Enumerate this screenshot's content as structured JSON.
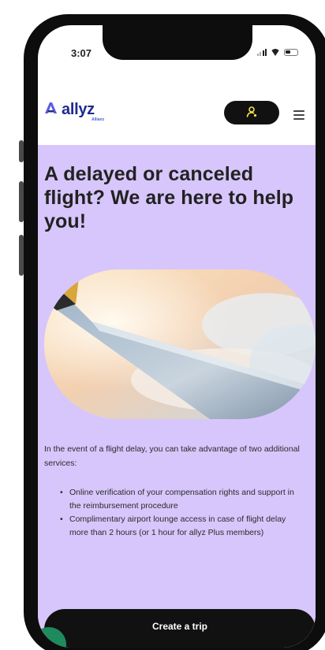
{
  "status_bar": {
    "time": "3:07"
  },
  "header": {
    "logo_text": "allyz",
    "logo_sub": "Allianz",
    "user_icon": "user-key-icon",
    "menu_icon": "hamburger-menu-icon"
  },
  "main": {
    "headline": "A delayed or canceled flight? We are here to help you!",
    "intro": "In the event of a flight delay, you can take advantage of two additional services:",
    "benefits": [
      "Online verification of your compensation rights and support in the reimbursement procedure",
      "Complimentary airport lounge access in case of flight delay more than 2 hours (or 1 hour for allyz Plus members)"
    ],
    "cta_label": "Create a trip"
  },
  "colors": {
    "brand_blue": "#1e2a8f",
    "accent_yellow": "#f2e14c",
    "content_bg": "#d7c6fb",
    "button_dark": "#111111",
    "chat_green": "#1f8a5e"
  }
}
